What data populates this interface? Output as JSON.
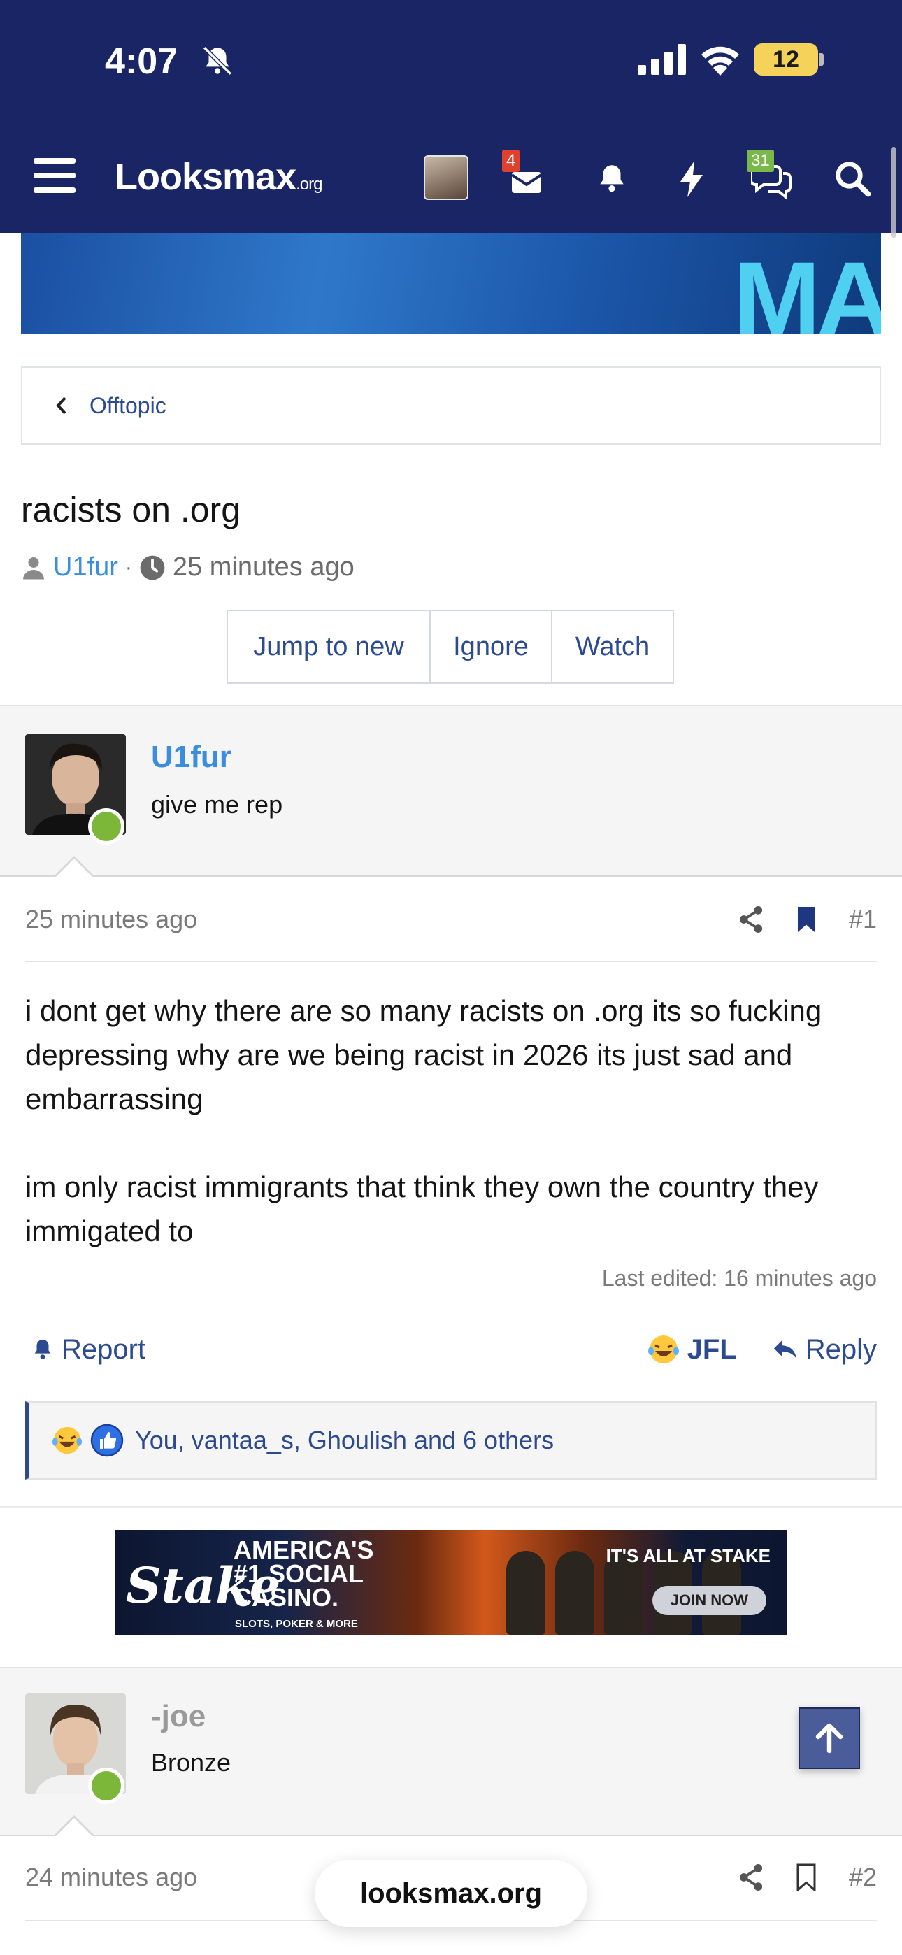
{
  "status_bar": {
    "time": "4:07",
    "battery": "12"
  },
  "nav": {
    "logo_main": "Looksmax",
    "logo_suffix": ".org",
    "inbox_badge": "4",
    "conversations_badge": "31"
  },
  "banner": {
    "text": "MA"
  },
  "breadcrumb": {
    "label": "Offtopic"
  },
  "thread": {
    "title": "racists on .org",
    "author": "U1fur",
    "separator": "·",
    "time": "25 minutes ago",
    "actions": [
      "Jump to new",
      "Ignore",
      "Watch"
    ]
  },
  "posts": [
    {
      "username": "U1fur",
      "user_title": "give me rep",
      "time": "25 minutes ago",
      "number": "#1",
      "body": [
        "i dont get why there are so many racists on .org its so fucking depressing why are we being racist in 2026 its just sad and embarrassing",
        "im only racist immigrants that think they own the country they immigated to"
      ],
      "last_edited": "Last edited: 16 minutes ago",
      "report_label": "Report",
      "reaction_label": "JFL",
      "reply_label": "Reply",
      "reactions_text": "You, vantaa_s, Ghoulish and 6 others"
    },
    {
      "username": "-joe",
      "user_title": "Bronze",
      "time": "24 minutes ago",
      "number": "#2"
    }
  ],
  "ad": {
    "brand": "Stake",
    "headline_lines": [
      "AMERICA'S",
      "#1 SOCIAL",
      "CASINO."
    ],
    "subline": "SLOTS, POKER & MORE",
    "tagline": "IT'S ALL AT STAKE",
    "cta": "JOIN NOW"
  },
  "browser": {
    "url": "looksmax.org"
  },
  "colors": {
    "header_bg": "#1a2565",
    "link": "#2c4a8f",
    "author_blue": "#3b8de2",
    "online_green": "#7cb73a"
  },
  "icons": [
    "muted-bell-icon",
    "signal-icon",
    "wifi-icon",
    "battery-icon",
    "hamburger-icon",
    "inbox-icon",
    "bell-icon",
    "bolt-icon",
    "chat-icon",
    "search-icon",
    "chevron-left-icon",
    "user-icon",
    "clock-icon",
    "share-icon",
    "bookmark-icon",
    "report-bell-icon",
    "laugh-cry-emoji-icon",
    "reply-icon",
    "thumbs-up-icon",
    "arrow-up-icon"
  ]
}
